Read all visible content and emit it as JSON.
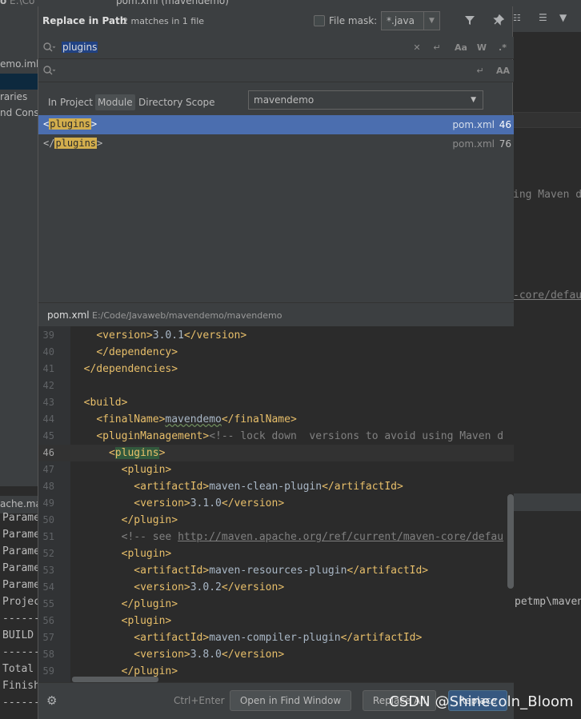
{
  "ide": {
    "top_fragment_left": "o",
    "top_path_fragment": "E:\\Co",
    "top_tab_fragment": "pom.xml (mavendemo)",
    "left_items": [
      "emo.iml",
      "raries",
      "nd Conso"
    ],
    "right_editor_lines": [
      "ing Maven d",
      "-core/defau"
    ],
    "right_bottom_line": "petmp\\maven",
    "left_bottom_header": "ache.ma",
    "left_bottom_lines": [
      "Parame",
      "Parame",
      "Parame",
      "Parame",
      "Parame",
      "Projec",
      "------",
      "BUILD",
      "------",
      "Total",
      "Finish",
      "------"
    ]
  },
  "dialog": {
    "title": "Replace in Path",
    "match_count": "2 matches in 1 file",
    "file_mask_label": "File mask:",
    "file_mask_value": "*.java",
    "search_text": "plugins",
    "replace_text": "",
    "scope_tabs": [
      "In Project",
      "Module",
      "Directory",
      "Scope"
    ],
    "active_scope": "Module",
    "module_value": "mavendemo",
    "results": [
      {
        "before": "<",
        "match": "plugins",
        "after": ">",
        "file": "pom.xml",
        "line": "46",
        "selected": true
      },
      {
        "before": "</",
        "match": "plugins",
        "after": ">",
        "file": "pom.xml",
        "line": "76",
        "selected": false
      }
    ],
    "preview_file": "pom.xml",
    "preview_path": "E:/Code/Javaweb/mavendemo/mavendemo",
    "shortcut": "Ctrl+Enter",
    "buttons": {
      "open_in_find_window": "Open in Find Window",
      "replace_all": "Replace All",
      "replace": "Replace"
    }
  },
  "code_lines": [
    {
      "n": "39",
      "indent": "    ",
      "parts": [
        [
          "tag",
          "<version>"
        ],
        [
          "txt",
          "3.0.1"
        ],
        [
          "tag",
          "</version>"
        ]
      ]
    },
    {
      "n": "40",
      "indent": "    ",
      "parts": [
        [
          "tag",
          "</dependency>"
        ]
      ]
    },
    {
      "n": "41",
      "indent": "  ",
      "parts": [
        [
          "tag",
          "</dependencies>"
        ]
      ]
    },
    {
      "n": "42",
      "indent": "",
      "parts": []
    },
    {
      "n": "43",
      "indent": "  ",
      "parts": [
        [
          "tag",
          "<build>"
        ]
      ]
    },
    {
      "n": "44",
      "indent": "    ",
      "parts": [
        [
          "tag",
          "<finalName>"
        ],
        [
          "squig",
          "mavendemo"
        ],
        [
          "tag",
          "</finalName>"
        ]
      ]
    },
    {
      "n": "45",
      "indent": "    ",
      "parts": [
        [
          "tag",
          "<pluginManagement>"
        ],
        [
          "cmt",
          "<!-- lock down  versions to avoid using Maven d"
        ]
      ]
    },
    {
      "n": "46",
      "indent": "      ",
      "parts": [
        [
          "tag",
          "<"
        ],
        [
          "tagsel",
          "plugins"
        ],
        [
          "tag",
          ">"
        ]
      ],
      "current": true
    },
    {
      "n": "47",
      "indent": "        ",
      "parts": [
        [
          "tag",
          "<plugin>"
        ]
      ]
    },
    {
      "n": "48",
      "indent": "          ",
      "parts": [
        [
          "tag",
          "<artifactId>"
        ],
        [
          "txt",
          "maven-clean-plugin"
        ],
        [
          "tag",
          "</artifactId>"
        ]
      ]
    },
    {
      "n": "49",
      "indent": "          ",
      "parts": [
        [
          "tag",
          "<version>"
        ],
        [
          "txt",
          "3.1.0"
        ],
        [
          "tag",
          "</version>"
        ]
      ]
    },
    {
      "n": "50",
      "indent": "        ",
      "parts": [
        [
          "tag",
          "</plugin>"
        ]
      ]
    },
    {
      "n": "51",
      "indent": "        ",
      "parts": [
        [
          "cmt",
          "<!-- see "
        ],
        [
          "lnk",
          "http://maven.apache.org/ref/current/maven-core/defau"
        ]
      ]
    },
    {
      "n": "52",
      "indent": "        ",
      "parts": [
        [
          "tag",
          "<plugin>"
        ]
      ]
    },
    {
      "n": "53",
      "indent": "          ",
      "parts": [
        [
          "tag",
          "<artifactId>"
        ],
        [
          "txt",
          "maven-resources-plugin"
        ],
        [
          "tag",
          "</artifactId>"
        ]
      ]
    },
    {
      "n": "54",
      "indent": "          ",
      "parts": [
        [
          "tag",
          "<version>"
        ],
        [
          "txt",
          "3.0.2"
        ],
        [
          "tag",
          "</version>"
        ]
      ]
    },
    {
      "n": "55",
      "indent": "        ",
      "parts": [
        [
          "tag",
          "</plugin>"
        ]
      ]
    },
    {
      "n": "56",
      "indent": "        ",
      "parts": [
        [
          "tag",
          "<plugin>"
        ]
      ]
    },
    {
      "n": "57",
      "indent": "          ",
      "parts": [
        [
          "tag",
          "<artifactId>"
        ],
        [
          "txt",
          "maven-compiler-plugin"
        ],
        [
          "tag",
          "</artifactId>"
        ]
      ]
    },
    {
      "n": "58",
      "indent": "          ",
      "parts": [
        [
          "tag",
          "<version>"
        ],
        [
          "txt",
          "3.8.0"
        ],
        [
          "tag",
          "</version>"
        ]
      ]
    },
    {
      "n": "59",
      "indent": "        ",
      "parts": [
        [
          "tag",
          "</plugin>"
        ]
      ]
    }
  ],
  "watermark": "CSDN @Shinecoln_Bloom"
}
